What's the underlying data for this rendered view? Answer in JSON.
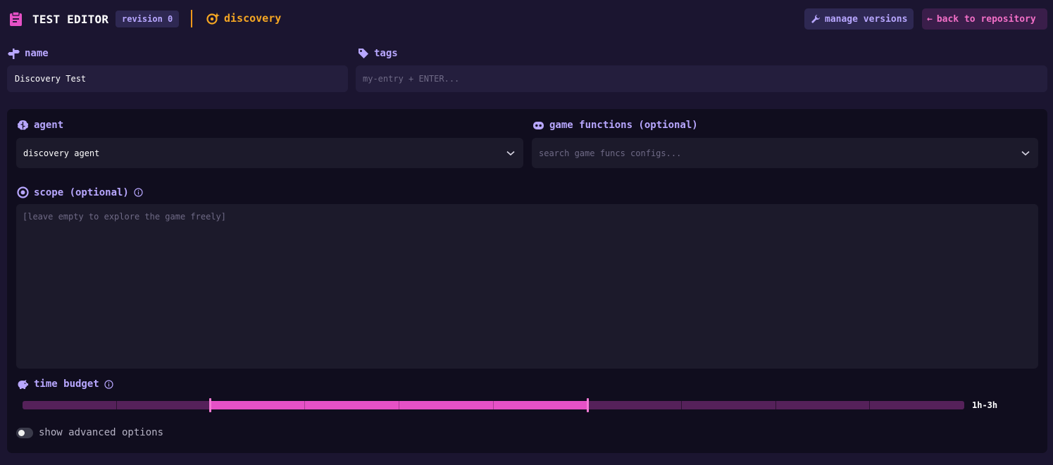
{
  "header": {
    "app_icon": "clipboard-icon",
    "title": "TEST EDITOR",
    "revision_badge": "revision 0",
    "mode_icon": "discovery-icon",
    "mode_label": "discovery",
    "manage_versions_label": "manage versions",
    "manage_versions_icon": "wrench-icon",
    "back_label": "back to repository",
    "back_arrow": "←"
  },
  "name_field": {
    "label": "name",
    "icon": "signpost-icon",
    "value": "Discovery Test"
  },
  "tags_field": {
    "label": "tags",
    "icon": "tag-icon",
    "placeholder": "my-entry + ENTER..."
  },
  "agent_field": {
    "label": "agent",
    "icon": "brain-icon",
    "value": "discovery agent",
    "chevron": "chevron-down-icon"
  },
  "game_functions_field": {
    "label": "game functions (optional)",
    "icon": "robot-icon",
    "placeholder": "search game funcs configs...",
    "chevron": "chevron-down-icon"
  },
  "scope_field": {
    "label": "scope (optional)",
    "icon": "target-icon",
    "info_icon": "info-icon",
    "placeholder": "[leave empty to explore the game freely]"
  },
  "time_budget": {
    "label": "time budget",
    "icon": "piggy-bank-icon",
    "info_icon": "info-icon",
    "steps": 10,
    "range_start_step": 2,
    "range_end_step": 6,
    "range_label": "1h-3h"
  },
  "advanced_toggle": {
    "label": "show advanced options",
    "enabled": false
  },
  "colors": {
    "background": "#1b1530",
    "panel": "#100d1e",
    "accent_purple": "#b8a7ff",
    "accent_orange": "#f5a623",
    "accent_pink": "#e651c6"
  }
}
